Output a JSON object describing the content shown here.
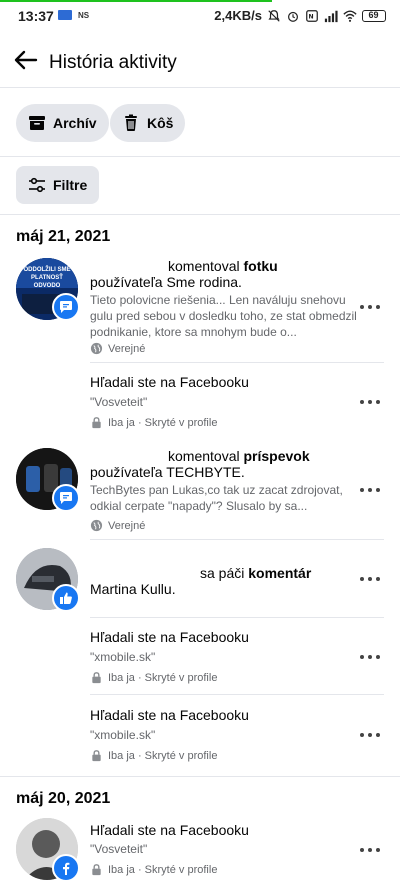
{
  "status": {
    "time": "13:37",
    "ns": "NS",
    "speed": "2,4KB/s",
    "battery": "69",
    "progress_fraction": 0.68
  },
  "header": {
    "title": "História aktivity"
  },
  "buttons": {
    "archive": "Archív",
    "trash": "Kôš",
    "filter": "Filtre"
  },
  "sections": [
    {
      "date": "máj 21, 2021"
    },
    {
      "date": "máj 20, 2021"
    }
  ],
  "items": [
    {
      "action": "komentoval",
      "object": "fotku",
      "target": "používateľa Sme rodina.",
      "snippet": "Tieto polovicne riešenia... Len naváluju snehovu gulu pred sebou v dosledku toho, ze stat obmedzil podnikanie, ktore sa mnohym bude o...",
      "privacy": "Verejné",
      "avatar_text": "ODDOLŽILI SME PLATNOSŤ ODVODO"
    },
    {
      "title": "Hľadali ste na Facebooku",
      "query": "\"Vosveteit\"",
      "privacy": "Iba ja · Skryté v profile"
    },
    {
      "action": "komentoval",
      "object": "príspevok",
      "target": "používateľa TECHBYTE.",
      "snippet": "TechBytes pan Lukas,co tak uz zacat zdrojovat, odkial cerpate \"napady\"? Slusalo by sa...",
      "privacy": "Verejné"
    },
    {
      "action": "sa páči",
      "object": "komentár",
      "target": "Martina Kullu."
    },
    {
      "title": "Hľadali ste na Facebooku",
      "query": "\"xmobile.sk\"",
      "privacy": "Iba ja · Skryté v profile"
    },
    {
      "title": "Hľadali ste na Facebooku",
      "query": "\"xmobile.sk\"",
      "privacy": "Iba ja · Skryté v profile"
    },
    {
      "title": "Hľadali ste na Facebooku",
      "query": "\"Vosveteit\"",
      "privacy": "Iba ja · Skryté v profile"
    }
  ],
  "colors": {
    "accent": "#1877f2",
    "pill_bg": "#e4e6eb",
    "muted": "#65676b",
    "progress": "#1ec21e"
  }
}
